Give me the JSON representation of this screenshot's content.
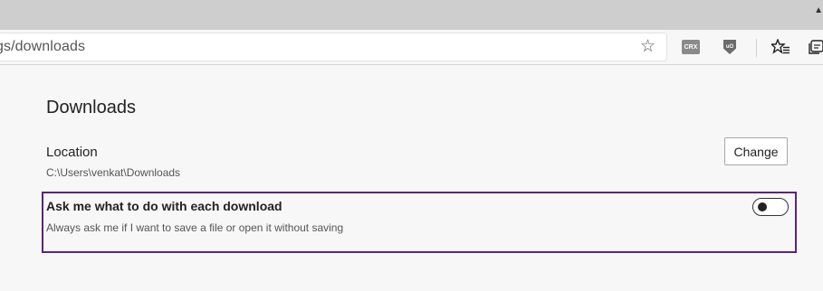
{
  "browser": {
    "address_text": "gs/downloads",
    "extensions": [
      {
        "name": "crx-extension-icon",
        "badge": "CRX"
      },
      {
        "name": "ublock-origin-icon",
        "badge": "uO"
      }
    ]
  },
  "downloads": {
    "title": "Downloads",
    "location_label": "Location",
    "location_path": "C:\\Users\\venkat\\Downloads",
    "change_button": "Change",
    "ask_label": "Ask me what to do with each download",
    "ask_description": "Always ask me if I want to save a file or open it without saving",
    "ask_toggle_on": false
  },
  "colors": {
    "highlight_border": "#5b2670",
    "titlebar": "#cecece",
    "page_background": "#f7f7f7"
  }
}
